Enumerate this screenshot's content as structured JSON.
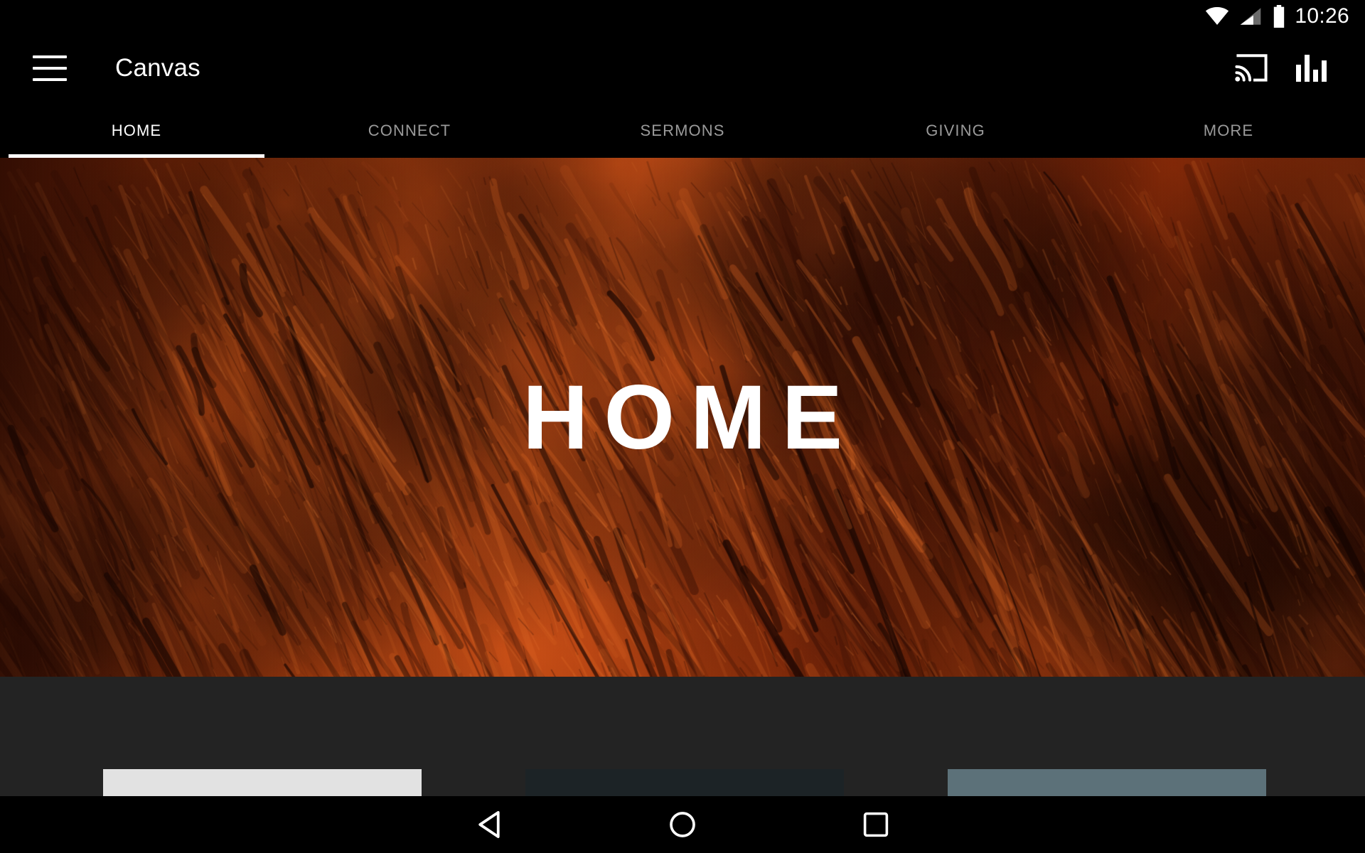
{
  "status_bar": {
    "time": "10:26",
    "icons": [
      "wifi-icon",
      "cellular-signal-icon",
      "battery-icon"
    ]
  },
  "app_bar": {
    "menu_icon": "hamburger-menu-icon",
    "title": "Canvas",
    "actions": [
      {
        "icon": "cast-icon",
        "label": "Cast"
      },
      {
        "icon": "equalizer-icon",
        "label": "Now Playing"
      }
    ]
  },
  "tabs": [
    {
      "label": "HOME",
      "active": true
    },
    {
      "label": "CONNECT",
      "active": false
    },
    {
      "label": "SERMONS",
      "active": false
    },
    {
      "label": "GIVING",
      "active": false
    },
    {
      "label": "MORE",
      "active": false
    }
  ],
  "hero": {
    "title": "HOME",
    "background_description": "orange rust textured paint surface"
  },
  "content_cards": [
    {
      "name": "card-1",
      "color": "#e2e2e2"
    },
    {
      "name": "card-2",
      "color": "#1c2326"
    },
    {
      "name": "card-3",
      "color": "#5c7179"
    }
  ],
  "nav_bar": {
    "back": {
      "icon": "back-triangle-icon",
      "label": "Back"
    },
    "home": {
      "icon": "home-circle-icon",
      "label": "Home"
    },
    "recents": {
      "icon": "recents-square-icon",
      "label": "Recents"
    }
  },
  "colors": {
    "app_bar_bg": "#000000",
    "tab_inactive": "#9a9a9a",
    "tab_active": "#ffffff",
    "hero_orange": "#c3420f",
    "hero_dark": "#3a1206",
    "content_bg": "#232323"
  }
}
